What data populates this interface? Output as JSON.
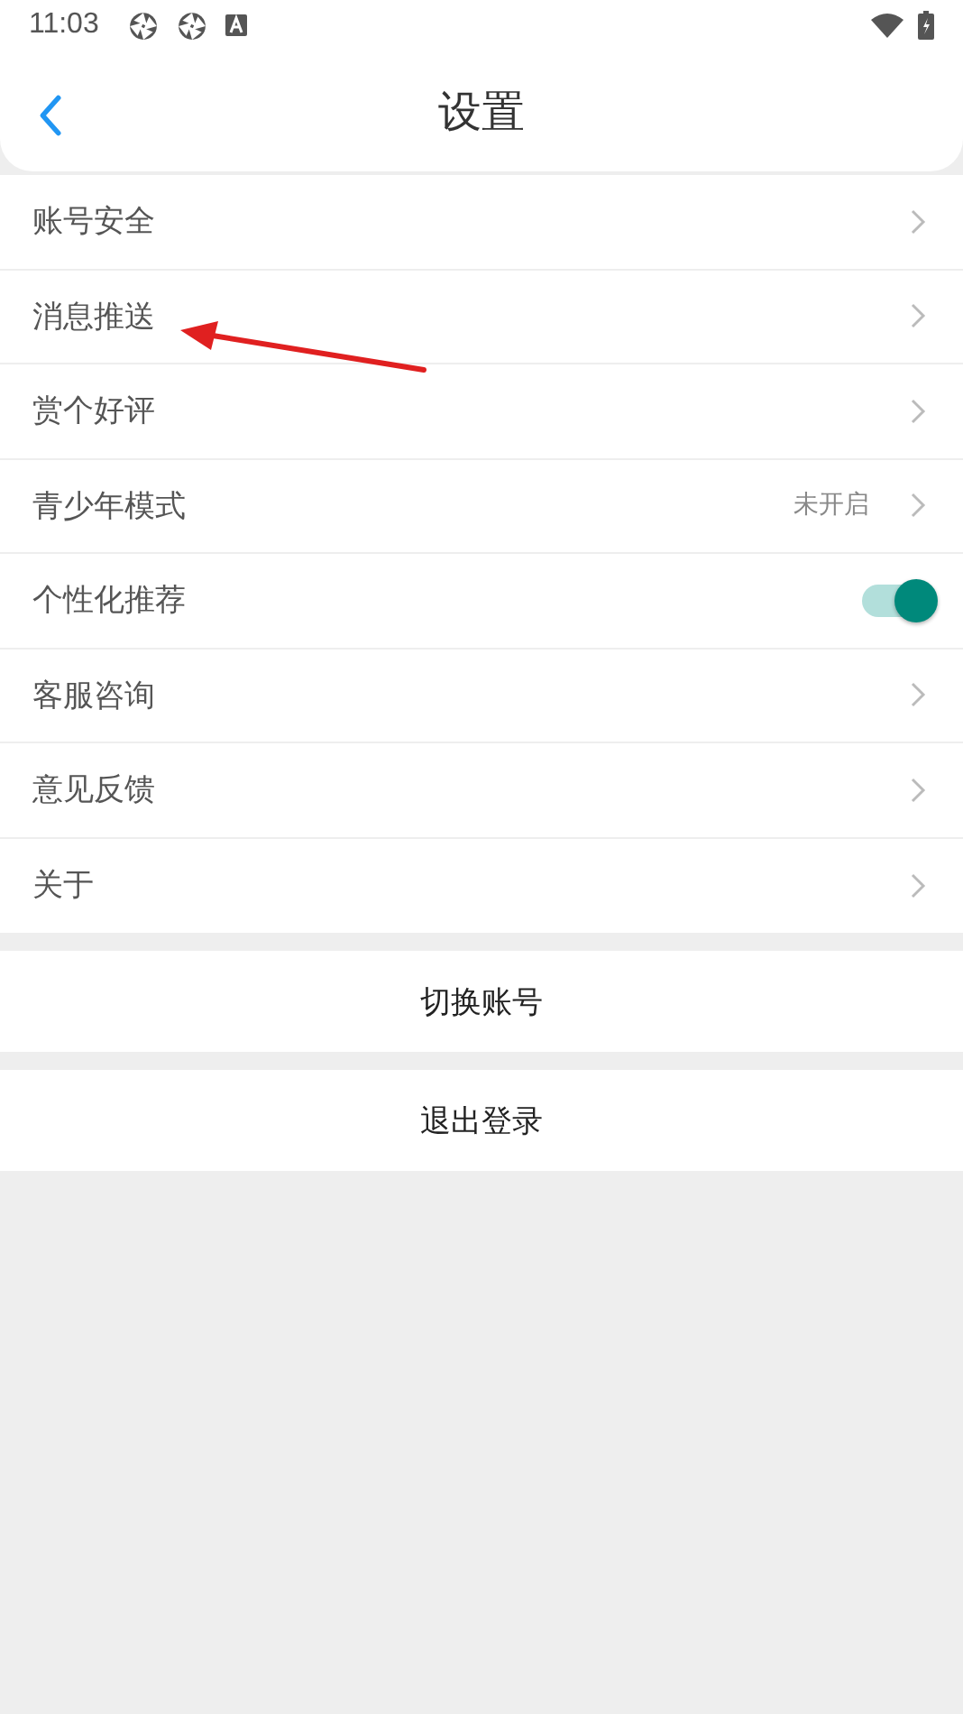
{
  "status_bar": {
    "time": "11:03"
  },
  "header": {
    "title": "设置"
  },
  "settings": [
    {
      "kind": "link",
      "label": "账号安全"
    },
    {
      "kind": "link",
      "label": "消息推送"
    },
    {
      "kind": "link",
      "label": "赏个好评"
    },
    {
      "kind": "link",
      "label": "青少年模式",
      "value": "未开启"
    },
    {
      "kind": "toggle",
      "label": "个性化推荐",
      "on": true
    },
    {
      "kind": "link",
      "label": "客服咨询"
    },
    {
      "kind": "link",
      "label": "意见反馈"
    },
    {
      "kind": "link",
      "label": "关于"
    }
  ],
  "actions": [
    "切换账号",
    "退出登录"
  ]
}
